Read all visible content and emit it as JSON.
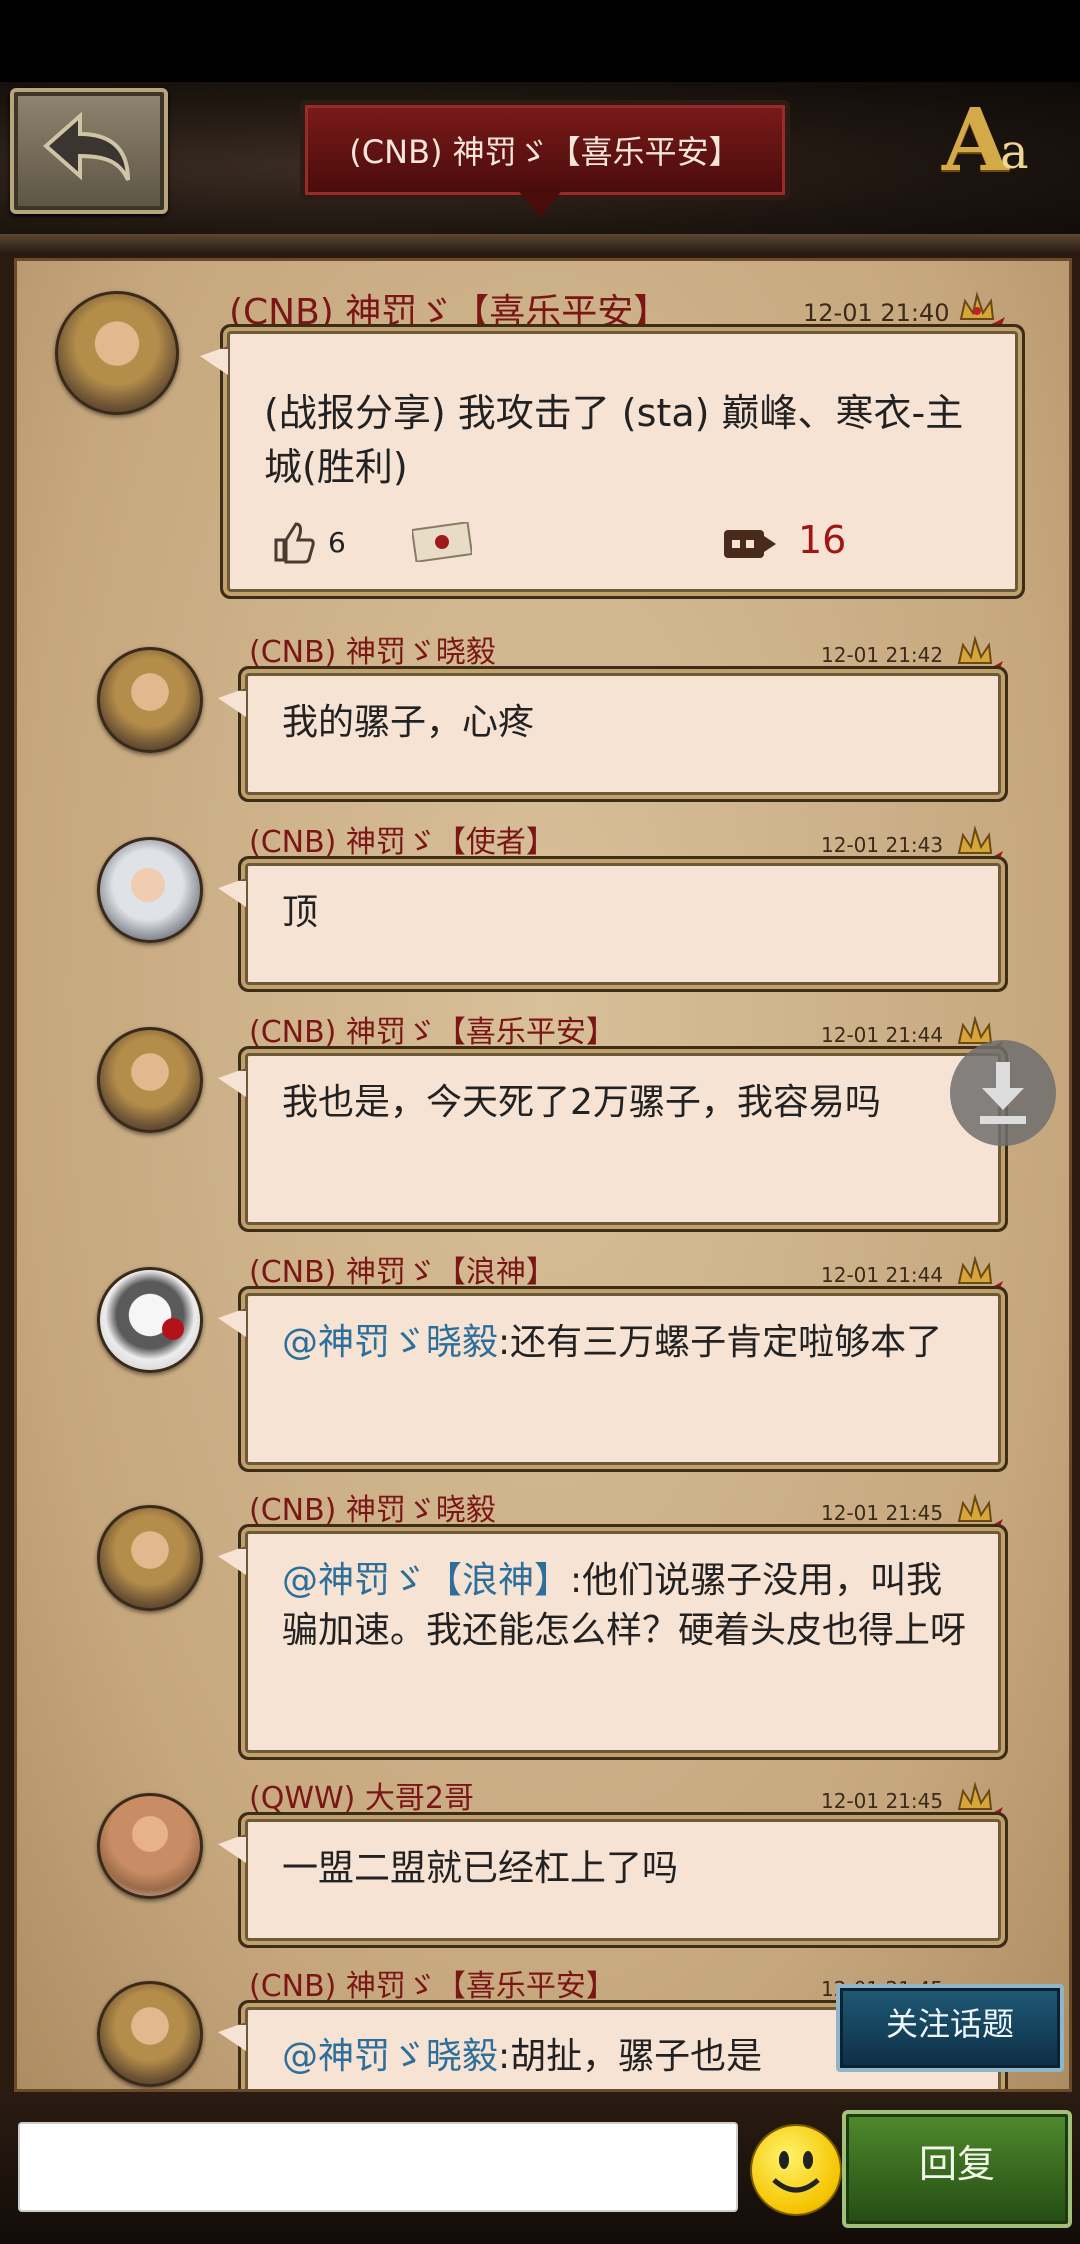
{
  "header": {
    "title": "(CNB) 神罚ゞ【喜乐平安】",
    "font_button_big": "A",
    "font_button_small": "a"
  },
  "messages": [
    {
      "author": "(CNB) 神罚ゞ【喜乐平安】",
      "time": "12-01 21:40",
      "text": "(战报分享) 我攻击了 (sta) 巅峰、寒衣-主城(胜利)",
      "likes": "6",
      "views": "16"
    },
    {
      "author": "(CNB) 神罚ゞ晓毅",
      "time": "12-01 21:42",
      "text": "我的骡子，心疼"
    },
    {
      "author": "(CNB) 神罚ゞ【使者】",
      "time": "12-01 21:43",
      "text": "顶"
    },
    {
      "author": "(CNB) 神罚ゞ【喜乐平安】",
      "time": "12-01 21:44",
      "text": "我也是，今天死了2万骡子，我容易吗"
    },
    {
      "author": "(CNB) 神罚ゞ【浪神】",
      "time": "12-01 21:44",
      "mention": "@神罚ゞ晓毅",
      "text": ":还有三万螺子肯定啦够本了"
    },
    {
      "author": "(CNB) 神罚ゞ晓毅",
      "time": "12-01 21:45",
      "mention": "@神罚ゞ【浪神】",
      "text": ":他们说骡子没用，叫我骗加速。我还能怎么样？硬着头皮也得上呀"
    },
    {
      "author": "(QWW) 大哥2哥",
      "time": "12-01 21:45",
      "text": "一盟二盟就已经杠上了吗"
    },
    {
      "author": "(CNB) 神罚ゞ【喜乐平安】",
      "time": "12-01 21:45",
      "mention": "@神罚ゞ晓毅",
      "text": ":胡扯，骡子也是"
    }
  ],
  "follow_button": "关注话题",
  "reply_button": "回复",
  "input": {
    "value": ""
  },
  "icons": {
    "back": "back-arrow-icon",
    "font": "font-size-icon",
    "like": "thumbs-up-icon",
    "mail": "letter-icon",
    "views": "video-icon",
    "download": "download-icon",
    "emoji": "smiley-icon",
    "crown": "crown-icon"
  },
  "colors": {
    "author": "#7a1616",
    "mention": "#2d6f9b",
    "bubble": "#f7e3d4",
    "views": "#a11515"
  }
}
